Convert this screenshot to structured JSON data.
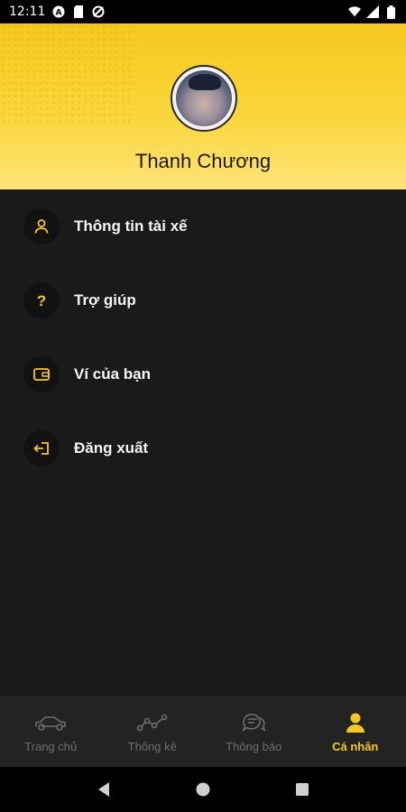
{
  "status_bar": {
    "time": "12:11",
    "left_icons": [
      "a-icon",
      "sd-card-icon",
      "sync-off-icon"
    ],
    "right_icons": [
      "wifi-icon",
      "signal-icon",
      "battery-icon"
    ]
  },
  "profile": {
    "name": "Thanh Chương"
  },
  "menu": {
    "items": [
      {
        "label": "Thông tin tài xế",
        "icon": "person-icon"
      },
      {
        "label": "Trợ giúp",
        "icon": "question-icon"
      },
      {
        "label": "Ví của bạn",
        "icon": "wallet-icon"
      },
      {
        "label": "Đăng xuất",
        "icon": "logout-icon"
      }
    ]
  },
  "bottom_nav": {
    "items": [
      {
        "label": "Trang chủ",
        "icon": "car-icon",
        "active": false
      },
      {
        "label": "Thống kê",
        "icon": "chart-icon",
        "active": false
      },
      {
        "label": "Thông báo",
        "icon": "chat-icon",
        "active": false
      },
      {
        "label": "Cá nhân",
        "icon": "person-icon",
        "active": true
      }
    ]
  },
  "colors": {
    "accent": "#f6c81e",
    "background": "#1a1a1a",
    "nav_background": "#232323",
    "inactive": "#6e6e6e"
  }
}
